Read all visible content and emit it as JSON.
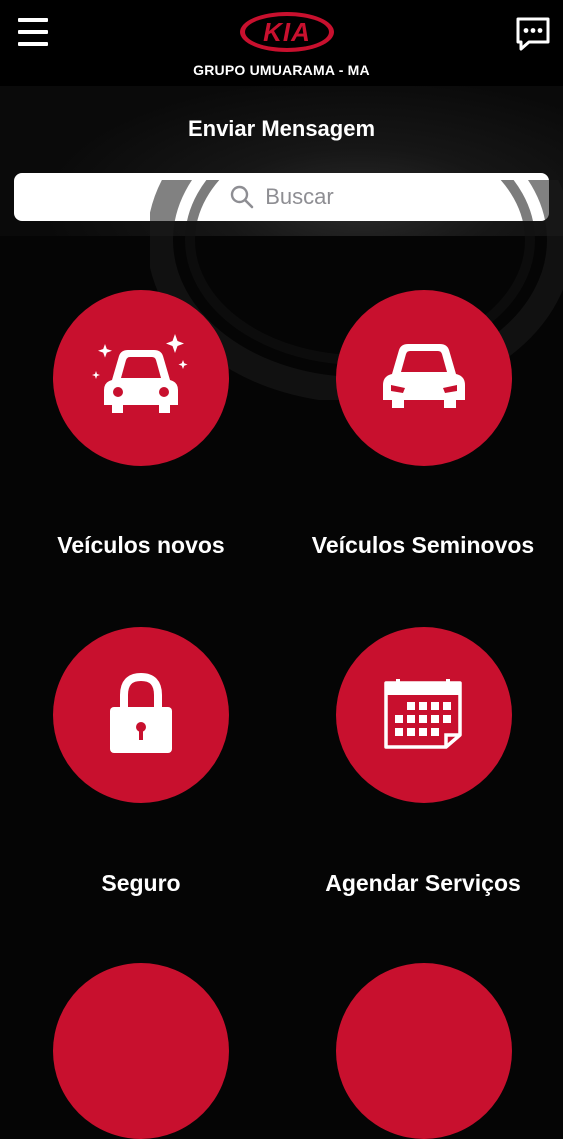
{
  "header": {
    "logo_text": "KIA",
    "dealer_name": "GRUPO UMUARAMA - MA",
    "menu_icon": "hamburger-menu-icon",
    "chat_icon": "chat-message-icon"
  },
  "main": {
    "send_message_label": "Enviar Mensagem",
    "search": {
      "placeholder": "Buscar",
      "icon": "search-icon"
    }
  },
  "tiles": [
    {
      "label": "Veículos novos",
      "icon": "new-car-sparkle-icon"
    },
    {
      "label": "Veículos Seminovos",
      "icon": "car-icon"
    },
    {
      "label": "Seguro",
      "icon": "padlock-icon"
    },
    {
      "label": "Agendar Serviços",
      "icon": "calendar-icon"
    },
    {
      "label": "",
      "icon": ""
    },
    {
      "label": "",
      "icon": ""
    }
  ],
  "colors": {
    "accent_red": "#c8102e",
    "background": "#050505",
    "text": "#ffffff",
    "search_placeholder": "#8e8e93"
  }
}
